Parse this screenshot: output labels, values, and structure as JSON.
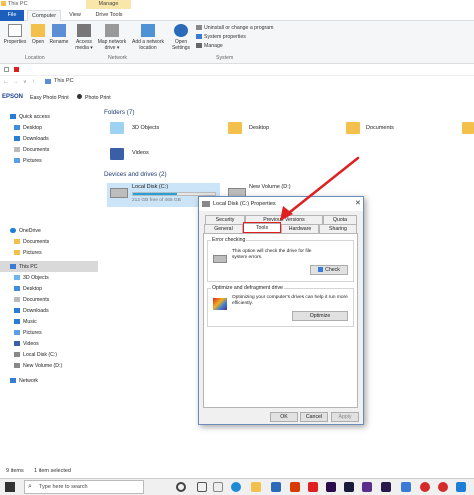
{
  "window": {
    "title": "This PC",
    "contextual_tab": "Manage"
  },
  "ribbon": {
    "tabs": [
      "File",
      "Computer",
      "View",
      "Drive Tools"
    ],
    "buttons": {
      "properties": "Properties",
      "open": "Open",
      "rename": "Rename",
      "access_media": "Access media ▾",
      "map_network": "Map network drive ▾",
      "add_network": "Add a network location",
      "open_settings": "Open Settings"
    },
    "system_items": [
      "Uninstall or change a program",
      "System properties",
      "Manage"
    ],
    "groups": [
      "Location",
      "Network",
      "System"
    ]
  },
  "address": {
    "path": "This PC"
  },
  "epson": {
    "brand": "EPSON",
    "item1": "Easy Photo Print",
    "item2": "Photo Print"
  },
  "nav": {
    "quick_access": "Quick access",
    "items": [
      "Desktop",
      "Downloads",
      "Documents",
      "Pictures"
    ],
    "onedrive": "OneDrive",
    "onedrive_items": [
      "Documents",
      "Pictures"
    ],
    "this_pc": "This PC",
    "pc_items": [
      "3D Objects",
      "Desktop",
      "Documents",
      "Downloads",
      "Music",
      "Pictures",
      "Videos",
      "Local Disk (C:)",
      "New Volume (D:)"
    ],
    "network": "Network"
  },
  "content": {
    "folders_header": "Folders (7)",
    "folders": [
      "3D Objects",
      "Desktop",
      "Documents",
      "Videos"
    ],
    "drives_header": "Devices and drives (2)",
    "drive_c": {
      "name": "Local Disk (C:)",
      "free": "212 GB free of 465 GB",
      "used_fraction": 0.54
    },
    "drive_d": {
      "name": "New Volume (D:)"
    }
  },
  "status": {
    "count": "9 items",
    "selected": "1 item selected"
  },
  "taskbar": {
    "search_placeholder": "Type here to search"
  },
  "dialog": {
    "title": "Local Disk (C:) Properties",
    "tabs_row1": [
      "Security",
      "Previous Versions",
      "Quota"
    ],
    "tabs_row2": [
      "General",
      "Tools",
      "Hardware",
      "Sharing"
    ],
    "error_group": "Error checking",
    "error_text": "This option will check the drive for file system errors.",
    "check_button": "Check",
    "optimize_group": "Optimize and defragment drive",
    "optimize_text": "Optimizing your computer's drives can help it run more efficiently.",
    "optimize_button": "Optimize",
    "ok": "OK",
    "cancel": "Cancel",
    "apply": "Apply"
  },
  "colors": {
    "accent": "#1c5fbd",
    "annotation": "#e02020",
    "folder": "#f4c04c"
  }
}
